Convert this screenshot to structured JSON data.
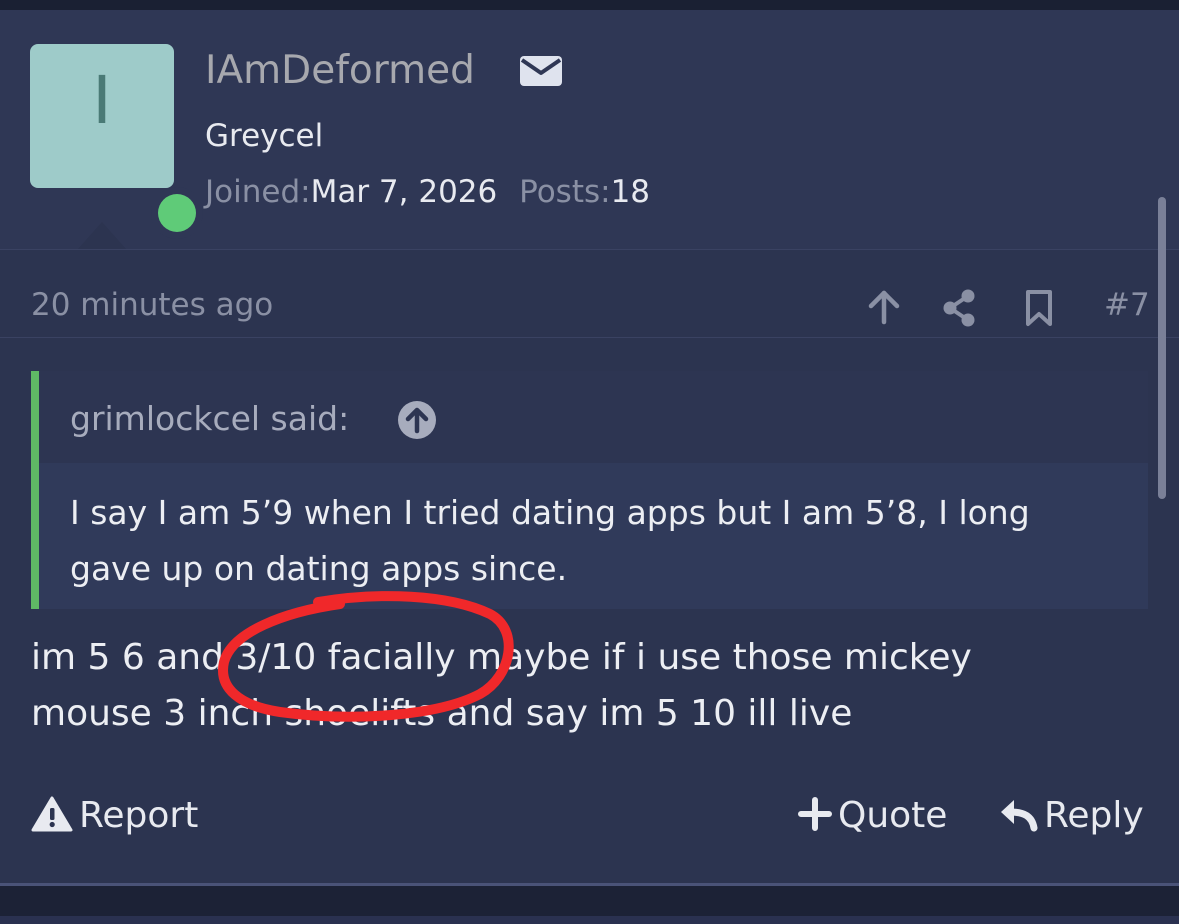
{
  "user": {
    "avatar_letter": "I",
    "username": "IAmDeformed",
    "title": "Greycel",
    "joined_label": "Joined:",
    "joined_value": "Mar 7, 2026",
    "posts_label": "Posts:",
    "posts_value": "18",
    "online": true
  },
  "post_meta": {
    "timestamp": "20 minutes ago",
    "post_number": "#7",
    "icons": [
      "arrow-up-icon",
      "share-icon",
      "bookmark-icon"
    ]
  },
  "quote": {
    "author": "grimlockcel said:",
    "line1": "I say I am 5’9 when I tried dating apps but I am 5’8, I long",
    "line2": "gave up on dating apps since."
  },
  "message": {
    "line1": "im 5 6 and 3/10 facially maybe if i use those mickey",
    "line2": "mouse 3 inch shoelifts and say im 5 10 ill live"
  },
  "actions": {
    "report": "Report",
    "quote": "Quote",
    "reply": "Reply"
  },
  "colors": {
    "background": "#2c3450",
    "quote_accent": "#5fb865",
    "online_dot": "#5fcb78",
    "avatar_bg": "#9ecbc9",
    "annotation_circle": "#f0282a"
  }
}
